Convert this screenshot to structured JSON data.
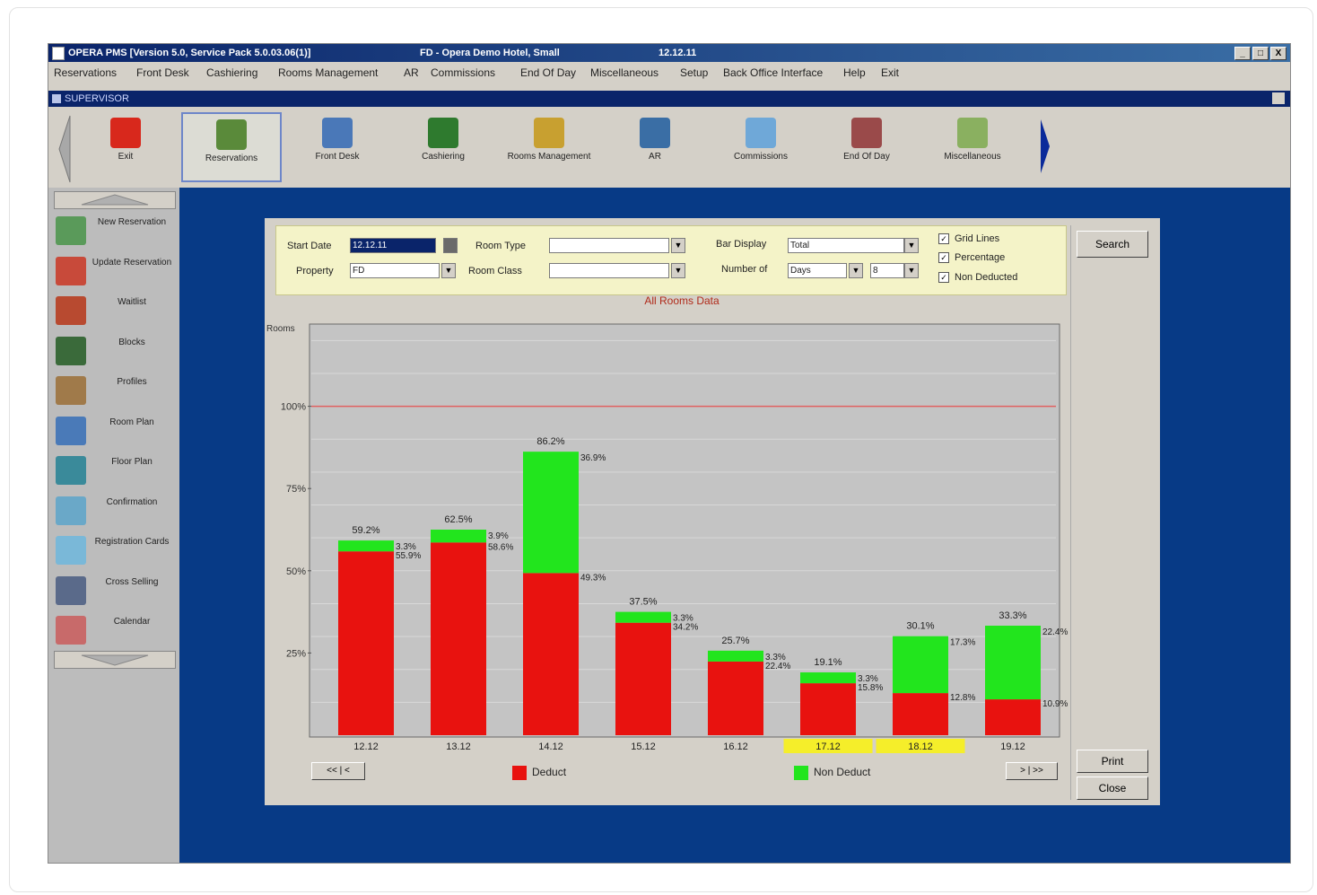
{
  "window": {
    "title": "OPERA PMS [Version 5.0, Service Pack 5.0.03.06(1)]",
    "hotel": "FD - Opera Demo Hotel, Small",
    "date": "12.12.11",
    "controls": [
      "_",
      "□",
      "X"
    ]
  },
  "menu": [
    "Reservations",
    "Front Desk",
    "Cashiering",
    "Rooms Management",
    "AR",
    "Commissions",
    "End Of Day",
    "Miscellaneous",
    "Setup",
    "Back Office Interface",
    "Help",
    "Exit"
  ],
  "subwindow": {
    "title": "SUPERVISOR"
  },
  "toolbar": {
    "buttons": [
      {
        "label": "Exit",
        "icon": "exit-door-icon",
        "color": "#d8281c"
      },
      {
        "label": "Reservations",
        "icon": "reservations-icon",
        "color": "#5a8a3a",
        "active": true
      },
      {
        "label": "Front Desk",
        "icon": "front-desk-icon",
        "color": "#4a78b8"
      },
      {
        "label": "Cashiering",
        "icon": "cashiering-icon",
        "color": "#2e7a2e"
      },
      {
        "label": "Rooms Management",
        "icon": "rooms-management-icon",
        "color": "#c8a030"
      },
      {
        "label": "AR",
        "icon": "ar-icon",
        "color": "#3a6ea5"
      },
      {
        "label": "Commissions",
        "icon": "commissions-icon",
        "color": "#6fa8d8"
      },
      {
        "label": "End Of Day",
        "icon": "end-of-day-icon",
        "color": "#9a4a4a"
      },
      {
        "label": "Miscellaneous",
        "icon": "miscellaneous-icon",
        "color": "#8ab060"
      }
    ]
  },
  "sidebar": {
    "items": [
      {
        "label": "New Reservation",
        "icon": "new-reservation-icon",
        "color": "#5a9a5a"
      },
      {
        "label": "Update Reservation",
        "icon": "update-reservation-icon",
        "color": "#c84a3a"
      },
      {
        "label": "Waitlist",
        "icon": "waitlist-icon",
        "color": "#b84a30"
      },
      {
        "label": "Blocks",
        "icon": "blocks-icon",
        "color": "#3a6a3a"
      },
      {
        "label": "Profiles",
        "icon": "profiles-icon",
        "color": "#a07a4a"
      },
      {
        "label": "Room Plan",
        "icon": "room-plan-icon",
        "color": "#4a7ab8"
      },
      {
        "label": "Floor Plan",
        "icon": "floor-plan-icon",
        "color": "#3a8a9a"
      },
      {
        "label": "Confirmation",
        "icon": "confirmation-icon",
        "color": "#6aa8c8"
      },
      {
        "label": "Registration Cards",
        "icon": "registration-cards-icon",
        "color": "#7ab8d8"
      },
      {
        "label": "Cross Selling",
        "icon": "cross-selling-icon",
        "color": "#5a6a8a"
      },
      {
        "label": "Calendar",
        "icon": "calendar-icon",
        "color": "#c86a6a"
      }
    ]
  },
  "filters": {
    "start_date_label": "Start Date",
    "start_date_value": "12.12.11",
    "property_label": "Property",
    "property_value": "FD",
    "room_type_label": "Room Type",
    "room_class_label": "Room Class",
    "bar_display_label": "Bar Display",
    "bar_display_value": "Total",
    "number_of_label": "Number of",
    "number_of_unit": "Days",
    "number_of_value": "8",
    "grid_lines_label": "Grid Lines",
    "percentage_label": "Percentage",
    "non_deducted_label": "Non Deducted",
    "check_mark": "✓"
  },
  "buttons": {
    "search": "Search",
    "print": "Print",
    "close": "Close",
    "prev_pair": [
      "<<",
      "<"
    ],
    "next_pair": [
      ">",
      ">>"
    ]
  },
  "chart_data": {
    "type": "bar",
    "stacked": true,
    "title": "All Rooms Data",
    "ylabel": "Rooms",
    "ylim": [
      0,
      125
    ],
    "yticks": [
      "25%",
      "50%",
      "75%",
      "100%"
    ],
    "reference_line": {
      "label": "100%",
      "value": 100,
      "color": "#e06060"
    },
    "grid": true,
    "categories": [
      "12.12",
      "13.12",
      "14.12",
      "15.12",
      "16.12",
      "17.12",
      "18.12",
      "19.12"
    ],
    "highlighted_categories": [
      "17.12",
      "18.12"
    ],
    "highlight_color": "#f5ee2a",
    "series": [
      {
        "name": "Deduct",
        "color": "#e8120f",
        "values": [
          55.9,
          58.6,
          49.3,
          34.2,
          22.4,
          15.8,
          12.8,
          10.9
        ]
      },
      {
        "name": "Non Deduct",
        "color": "#22e51d",
        "values": [
          3.3,
          3.9,
          36.9,
          3.3,
          3.3,
          3.3,
          17.3,
          22.4
        ]
      }
    ],
    "total_labels": [
      "59.2%",
      "62.5%",
      "86.2%",
      "37.5%",
      "25.7%",
      "19.1%",
      "30.1%",
      "33.3%"
    ],
    "segment_labels": {
      "deduct": [
        "55.9%",
        "58.6%",
        "49.3%",
        "34.2%",
        "22.4%",
        "15.8%",
        "12.8%",
        "10.9%"
      ],
      "non_deduct": [
        "3.3%",
        "3.9%",
        "36.9%",
        "3.3%",
        "3.3%",
        "3.3%",
        "17.3%",
        "22.4%"
      ]
    },
    "legend": [
      "Deduct",
      "Non Deduct"
    ]
  }
}
